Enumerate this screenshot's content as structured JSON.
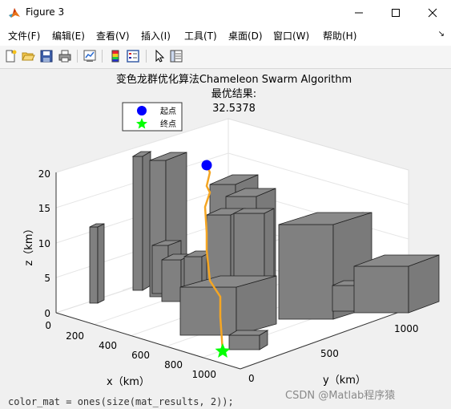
{
  "window": {
    "title": "Figure 3",
    "minimize_icon": "minimize-icon",
    "maximize_icon": "maximize-icon",
    "close_icon": "close-icon"
  },
  "menu": [
    "文件(F)",
    "编辑(E)",
    "查看(V)",
    "插入(I)",
    "工具(T)",
    "桌面(D)",
    "窗口(W)",
    "帮助(H)"
  ],
  "toolbar_icons": [
    "new-figure-icon",
    "open-file-icon",
    "save-icon",
    "print-icon",
    "link-plot-icon",
    "colorbar-icon",
    "legend-icon",
    "pointer-icon",
    "property-inspector-icon"
  ],
  "figure": {
    "title_line1": "变色龙群优化算法Chameleon Swarm Algorithm",
    "title_line2": "最优结果:",
    "title_line3": "32.5378",
    "legend": [
      {
        "label": "起点",
        "color": "#0000ff",
        "marker": "circle"
      },
      {
        "label": "终点",
        "color": "#00ff00",
        "marker": "star"
      }
    ],
    "zlabel": "z（km）",
    "xlabel": "x（km）",
    "ylabel": "y（km）",
    "z_ticks": [
      "0",
      "5",
      "10",
      "15",
      "20"
    ],
    "x_ticks": [
      "0",
      "200",
      "400",
      "600",
      "800",
      "1000"
    ],
    "y_ticks": [
      "0",
      "500",
      "1000"
    ],
    "path_color": "#f5a623",
    "obstacle_color": "#808080"
  },
  "bottom_code": "color_mat = ones(size(mat_results, 2));",
  "watermark": "CSDN @Matlab程序猿"
}
